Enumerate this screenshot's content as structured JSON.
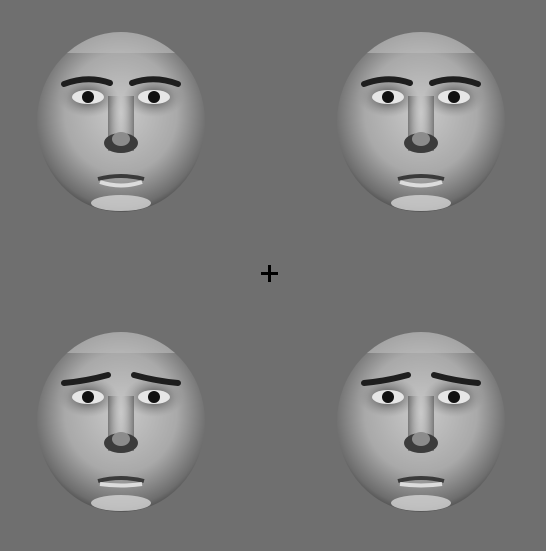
{
  "background_color": "#6f6f6f",
  "fixation_cross_color": "#000000",
  "stimuli": [
    {
      "slot": "top-left",
      "expression": "neutral"
    },
    {
      "slot": "top-right",
      "expression": "neutral"
    },
    {
      "slot": "bottom-left",
      "expression": "sad"
    },
    {
      "slot": "bottom-right",
      "expression": "sad"
    }
  ]
}
